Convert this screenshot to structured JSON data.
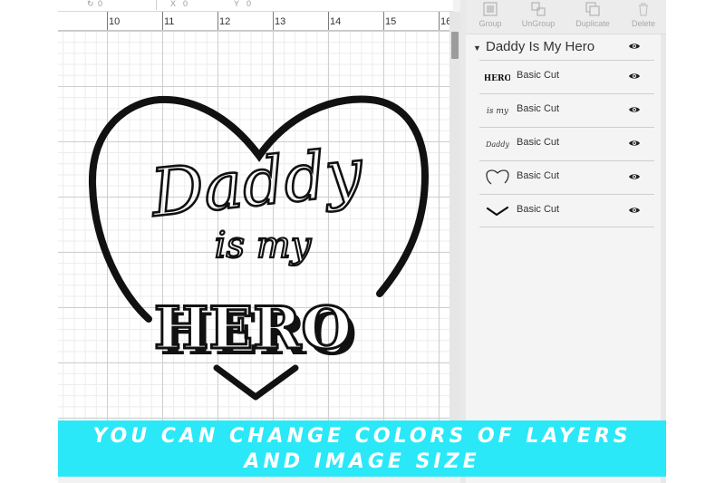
{
  "toolbar": {
    "rotate_value": "0",
    "x_label": "X",
    "x_value": "0",
    "y_label": "Y",
    "y_value": "0"
  },
  "ruler": {
    "numbers": [
      "10",
      "11",
      "12",
      "13",
      "14",
      "15",
      "16"
    ]
  },
  "artwork": {
    "line1": "Daddy",
    "line2": "is my",
    "line3": "HERO"
  },
  "layers_panel": {
    "buttons": [
      {
        "label": "Group",
        "icon": "group-icon"
      },
      {
        "label": "UnGroup",
        "icon": "ungroup-icon"
      },
      {
        "label": "Duplicate",
        "icon": "duplicate-icon"
      },
      {
        "label": "Delete",
        "icon": "trash-icon"
      }
    ],
    "group_title": "Daddy Is My Hero",
    "layers": [
      {
        "name": "Basic Cut",
        "thumb_text": "HERO",
        "thumb": "hero-text"
      },
      {
        "name": "Basic Cut",
        "thumb_text": "is my",
        "thumb": "is-my-text"
      },
      {
        "name": "Basic Cut",
        "thumb_text": "Daddy",
        "thumb": "daddy-text"
      },
      {
        "name": "Basic Cut",
        "thumb": "heart-outline"
      },
      {
        "name": "Basic Cut",
        "thumb": "chevron-stroke"
      }
    ]
  },
  "banner": {
    "line1": "YOU CAN CHANGE COLORS OF LAYERS",
    "line2": "AND IMAGE SIZE",
    "color": "#2ae8f7"
  },
  "colors": {
    "artwork": "#111111",
    "grid_major": "#cfcfcf",
    "grid_minor": "#ececec",
    "panel_bg": "#f4f4f4"
  }
}
